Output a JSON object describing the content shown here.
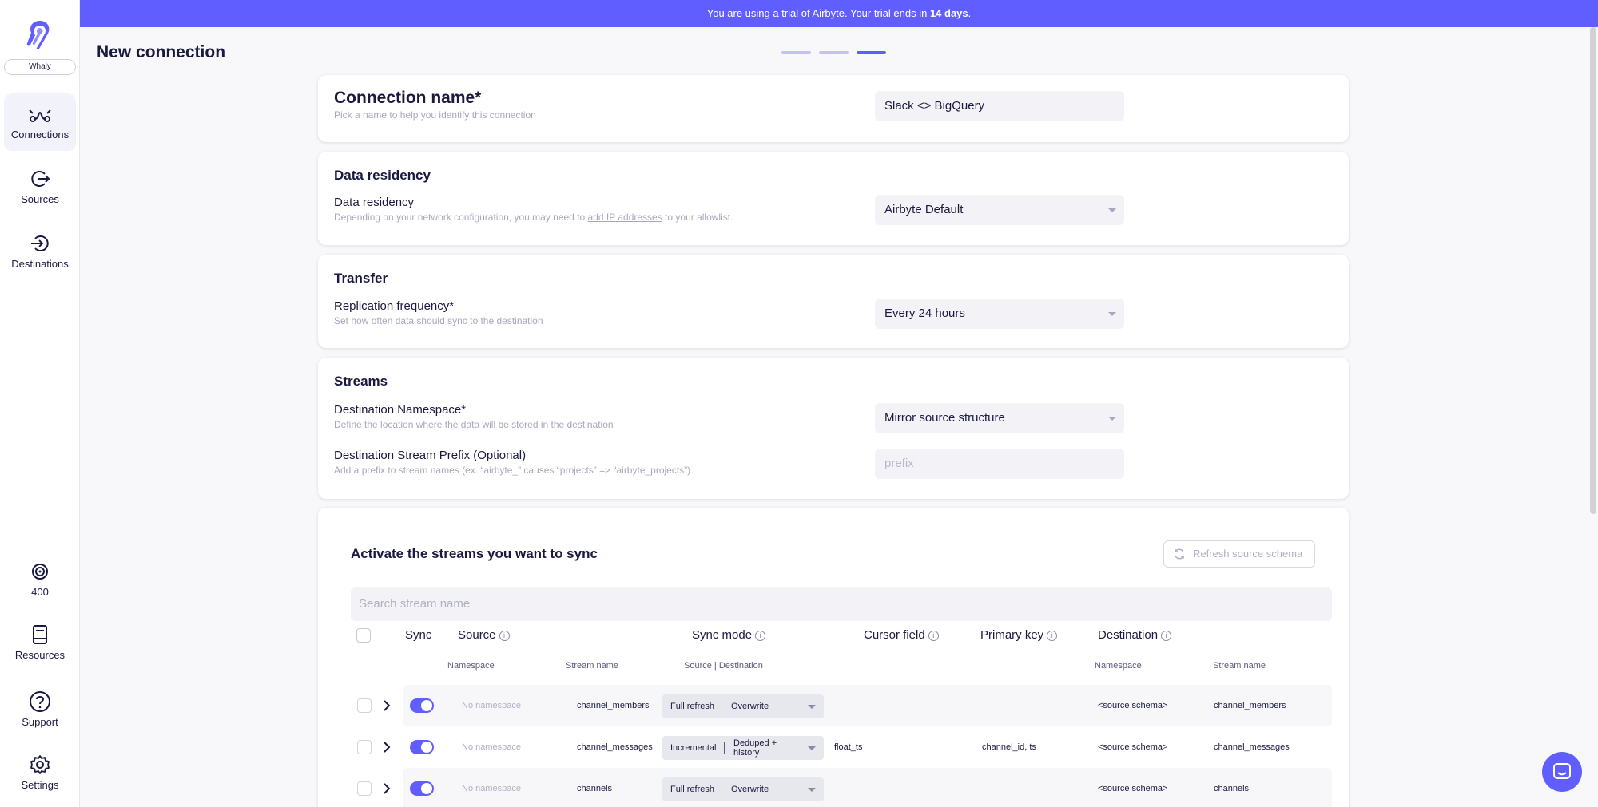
{
  "banner": {
    "prefix": "You are using a trial of Airbyte. Your trial ends in ",
    "days": "14 days",
    "suffix": "."
  },
  "sidebar": {
    "workspace": "Whaly",
    "items": [
      {
        "label": "Connections",
        "icon": "connections-icon"
      },
      {
        "label": "Sources",
        "icon": "sources-icon"
      },
      {
        "label": "Destinations",
        "icon": "destinations-icon"
      }
    ],
    "bottom": [
      {
        "label": "400",
        "icon": "credits-icon"
      },
      {
        "label": "Resources",
        "icon": "resources-icon"
      },
      {
        "label": "Support",
        "icon": "support-icon"
      },
      {
        "label": "Settings",
        "icon": "settings-icon"
      }
    ]
  },
  "page": {
    "title": "New connection",
    "step_current": 3,
    "step_total": 3
  },
  "connection_name": {
    "label": "Connection name*",
    "help": "Pick a name to help you identify this connection",
    "value": "Slack <> BigQuery"
  },
  "data_residency": {
    "heading": "Data residency",
    "label": "Data residency",
    "help_before": "Depending on your network configuration, you may need to ",
    "help_link": "add IP addresses",
    "help_after": " to your allowlist.",
    "value": "Airbyte Default"
  },
  "transfer": {
    "heading": "Transfer",
    "label": "Replication frequency*",
    "help": "Set how often data should sync to the destination",
    "value": "Every 24 hours"
  },
  "streams_config": {
    "heading": "Streams",
    "namespace_label": "Destination Namespace*",
    "namespace_help": "Define the location where the data will be stored in the destination",
    "namespace_value": "Mirror source structure",
    "prefix_label": "Destination Stream Prefix (Optional)",
    "prefix_help": "Add a prefix to stream names (ex. “airbyte_” causes “projects” => “airbyte_projects”)",
    "prefix_placeholder": "prefix"
  },
  "streams_table": {
    "title": "Activate the streams you want to sync",
    "refresh_label": "Refresh source schema",
    "search_placeholder": "Search stream name",
    "headers": {
      "sync": "Sync",
      "source": "Source",
      "sync_mode": "Sync mode",
      "cursor_field": "Cursor field",
      "primary_key": "Primary key",
      "destination": "Destination"
    },
    "subheaders": {
      "namespace": "Namespace",
      "stream_name": "Stream name",
      "source_dest": "Source | Destination",
      "dest_namespace": "Namespace",
      "dest_stream_name": "Stream name"
    },
    "info_glyph": "i",
    "rows": [
      {
        "src_namespace": "No namespace",
        "stream": "channel_members",
        "mode_source": "Full refresh",
        "mode_dest": "Overwrite",
        "mode_dest_2": "",
        "cursor": "",
        "pk": "",
        "dest_namespace": "<source schema>",
        "dest_stream": "channel_members",
        "enabled": true
      },
      {
        "src_namespace": "No namespace",
        "stream": "channel_messages",
        "mode_source": "Incremental",
        "mode_dest": "Deduped +",
        "mode_dest_2": "history",
        "cursor": "float_ts",
        "pk": "channel_id, ts",
        "dest_namespace": "<source schema>",
        "dest_stream": "channel_messages",
        "enabled": true
      },
      {
        "src_namespace": "No namespace",
        "stream": "channels",
        "mode_source": "Full refresh",
        "mode_dest": "Overwrite",
        "mode_dest_2": "",
        "cursor": "",
        "pk": "",
        "dest_namespace": "<source schema>",
        "dest_stream": "channels",
        "enabled": true
      }
    ]
  },
  "colors": {
    "brand": "#615eff",
    "text": "#1a1a40",
    "muted": "#a8a8bd",
    "field_bg": "#f3f3f7"
  }
}
